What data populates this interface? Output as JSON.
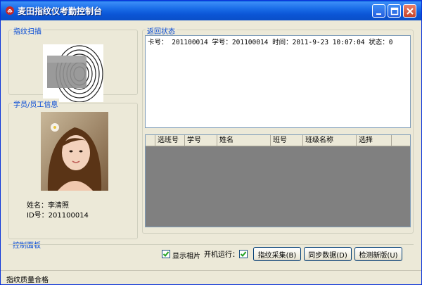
{
  "window": {
    "title": "麦田指纹仪考勤控制台",
    "accent": "#0a5fdc"
  },
  "fingerprint_group": {
    "title": "指纹扫描"
  },
  "person_group": {
    "title": "学员/员工信息",
    "name_label": "姓名：",
    "name_value": "李清照",
    "id_label": "ID号：",
    "id_value": "201100014"
  },
  "status_group": {
    "title": "返回状态",
    "log_line": "卡号： 201100014 学号：201100014 时间：2011-9-23 10:07:04 状态：0"
  },
  "grid": {
    "columns": [
      "选班号",
      "学号",
      "姓名",
      "班号",
      "班级名称",
      "选择"
    ]
  },
  "control_group": {
    "title": "控制面板",
    "show_photo_label": "显示相片",
    "show_photo_checked": true,
    "auto_start_label": "开机运行：",
    "auto_start_checked": true,
    "btn_collect": "指纹采集(B)",
    "btn_sync": "同步数据(D)",
    "btn_check": "检测新版(U)"
  },
  "statusbar": {
    "text": "指纹质量合格"
  }
}
